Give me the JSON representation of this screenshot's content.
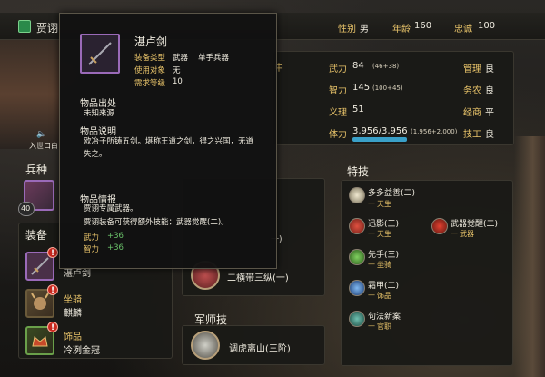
{
  "header": {
    "name_fragment": "贾诩",
    "gender_label": "性别",
    "gender": "男",
    "age_label": "年龄",
    "age": "160",
    "loyalty_label": "忠诚",
    "loyalty": "100"
  },
  "portrait": {
    "status_text": "入世口白"
  },
  "left": {
    "troop_title": "兵种",
    "troop_level": "40",
    "equip_title": "装备",
    "weapon_name_fragment": "湛卢剑",
    "mount_type": "坐骑",
    "mount_name": "麒麟",
    "accessory_type": "饰品",
    "accessory_name": "冷冽金冠"
  },
  "stats": {
    "tag_fragment": "中",
    "force_label": "武力",
    "force": "84",
    "force_detail": "(46+38)",
    "intel_label": "智力",
    "intel": "145",
    "intel_detail": "(100+45)",
    "politics_label": "义理",
    "politics": "51",
    "stamina_label": "体力",
    "stamina": "3,956/3,956",
    "stamina_detail": "(1,956+2,000)",
    "manage_label": "管理",
    "manage": "良",
    "farm_label": "务农",
    "farm": "良",
    "business_label": "经商",
    "business": "平",
    "craft_label": "技工",
    "craft": "良"
  },
  "mid": {
    "combat_skill_fragment": "二横带三纵(一)",
    "skill_fragment_top": "一)",
    "strategist_title": "军师技",
    "strategist_skill": "调虎离山(三阶)"
  },
  "traits": {
    "title": "特技",
    "items": [
      {
        "name": "多多益善(二)",
        "sub": "天生"
      },
      {
        "name": "迅影(三)",
        "sub": "天生"
      },
      {
        "name": "武器觉醒(二)",
        "sub": "武器"
      },
      {
        "name": "先手(三)",
        "sub": "坐骑"
      },
      {
        "name": "霜甲(二)",
        "sub": "饰品"
      },
      {
        "name": "句法新案",
        "sub": "官职"
      }
    ]
  },
  "tooltip": {
    "item_name": "湛卢剑",
    "equip_type_label": "装备类型",
    "equip_type": "武器",
    "weapon_class": "单手兵器",
    "use_target_label": "使用对象",
    "use_target": "无",
    "req_level_label": "需求等级",
    "req_level": "10",
    "origin_title": "物品出处",
    "origin": "未知来源",
    "desc_title": "物品说明",
    "desc_line1": "欧冶子所铸五剑。堪称王道之剑，得之兴国，无道",
    "desc_line2": "失之。",
    "info_title": "物品情报",
    "info_line1": "贾诩专属武器。",
    "info_line2": "贾诩装备可获得额外技能：武器觉醒(二)。",
    "bonus1_label": "武力",
    "bonus1": "+36",
    "bonus2_label": "智力",
    "bonus2": "+36"
  },
  "colors": {
    "gold": "#e9c46a",
    "green": "#6ac26a",
    "stamina_bar": "#3aa0c8",
    "alert_red": "#c8281e"
  }
}
